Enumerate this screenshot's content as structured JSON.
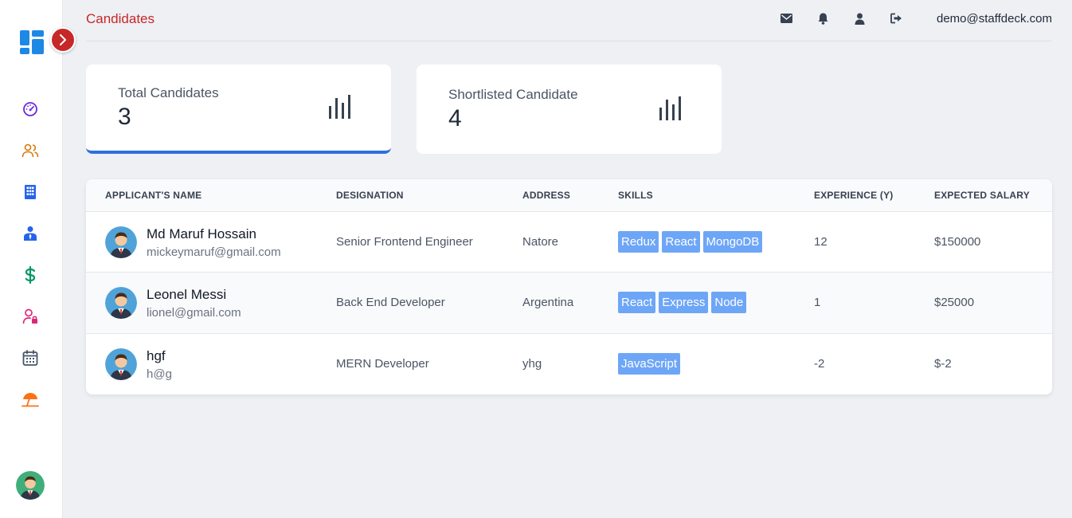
{
  "header": {
    "title": "Candidates",
    "user_email": "demo@staffdeck.com",
    "icons": [
      "mail-icon",
      "bell-icon",
      "user-icon",
      "logout-icon"
    ]
  },
  "sidebar": {
    "items": [
      {
        "name": "dashboard",
        "icon": "gauge-icon",
        "color": "#6d28d9"
      },
      {
        "name": "candidates",
        "icon": "users-icon",
        "color": "#d97706"
      },
      {
        "name": "company",
        "icon": "building-icon",
        "color": "#2563eb"
      },
      {
        "name": "employees",
        "icon": "employee-icon",
        "color": "#2563eb"
      },
      {
        "name": "payroll",
        "icon": "dollar-icon",
        "color": "#059669"
      },
      {
        "name": "user-access",
        "icon": "user-lock-icon",
        "color": "#db2777"
      },
      {
        "name": "calendar",
        "icon": "calendar-icon",
        "color": "#475569"
      },
      {
        "name": "holidays",
        "icon": "umbrella-icon",
        "color": "#f97316"
      }
    ]
  },
  "stats": [
    {
      "label": "Total Candidates",
      "value": "3"
    },
    {
      "label": "Shortlisted Candidate",
      "value": "4"
    }
  ],
  "table": {
    "columns": [
      "APPLICANT'S NAME",
      "DESIGNATION",
      "ADDRESS",
      "SKILLS",
      "EXPERIENCE (Y)",
      "EXPECTED SALARY"
    ],
    "rows": [
      {
        "name": "Md Maruf Hossain",
        "email": "mickeymaruf@gmail.com",
        "designation": "Senior Frontend Engineer",
        "address": "Natore",
        "skills": [
          "Redux",
          "React",
          "MongoDB"
        ],
        "experience": "12",
        "salary": "$150000"
      },
      {
        "name": "Leonel Messi",
        "email": "lionel@gmail.com",
        "designation": "Back End Developer",
        "address": "Argentina",
        "skills": [
          "React",
          "Express",
          "Node"
        ],
        "experience": "1",
        "salary": "$25000"
      },
      {
        "name": "hgf",
        "email": "h@g",
        "designation": "MERN Developer",
        "address": "yhg",
        "skills": [
          "JavaScript"
        ],
        "experience": "-2",
        "salary": "$-2"
      }
    ]
  },
  "colors": {
    "accent": "#c62828",
    "active_card": "#2f6fde",
    "skill_badge": "#6ea6f7"
  }
}
